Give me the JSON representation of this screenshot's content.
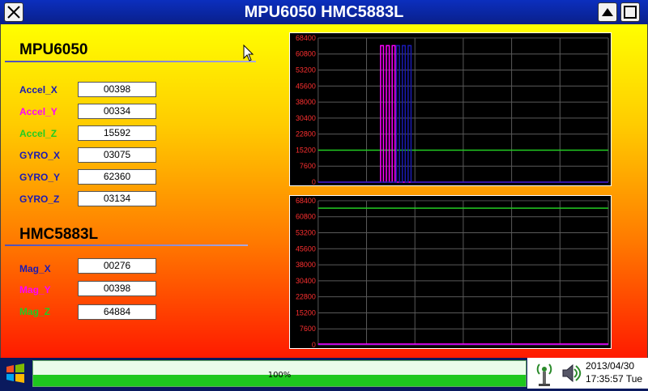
{
  "window": {
    "title": "MPU6050 HMC5883L"
  },
  "mpu": {
    "header": "MPU6050",
    "sensors": [
      {
        "label": "Accel_X",
        "value": "00398",
        "color": "#1a1ab4"
      },
      {
        "label": "Accel_Y",
        "value": "00334",
        "color": "#ff00ff"
      },
      {
        "label": "Accel_Z",
        "value": "15592",
        "color": "#22cc22"
      },
      {
        "label": "GYRO_X",
        "value": "03075",
        "color": "#1a1ab4"
      },
      {
        "label": "GYRO_Y",
        "value": "62360",
        "color": "#1a1ab4"
      },
      {
        "label": "GYRO_Z",
        "value": "03134",
        "color": "#1a1ab4"
      }
    ]
  },
  "hmc": {
    "header": "HMC5883L",
    "sensors": [
      {
        "label": "Mag_X",
        "value": "00276",
        "color": "#1a1ab4"
      },
      {
        "label": "Mag_Y",
        "value": "00398",
        "color": "#ff00ff"
      },
      {
        "label": "Mag_Z",
        "value": "64884",
        "color": "#22cc22"
      }
    ]
  },
  "chart_data": [
    {
      "type": "line",
      "ylim": [
        0,
        68400
      ],
      "yticks": [
        "68400",
        "60800",
        "53200",
        "45600",
        "38000",
        "30400",
        "22800",
        "15200",
        "7600",
        "0"
      ],
      "grid": true,
      "series": [
        {
          "color": "#22cc22",
          "x": [
            0,
            100
          ],
          "y": [
            15200,
            15200
          ]
        },
        {
          "color": "#ff00ff",
          "x": [
            0,
            21.5,
            21.5,
            22.5,
            22.5,
            23.5,
            23.5,
            24.5,
            24.5,
            25.5,
            25.5,
            26.5,
            26.5,
            100
          ],
          "y": [
            0,
            0,
            64800,
            64800,
            0,
            0,
            64800,
            64800,
            0,
            0,
            64800,
            64800,
            0,
            0
          ]
        },
        {
          "color": "#1a1ab4",
          "x": [
            0,
            27,
            27,
            28,
            28,
            29,
            29,
            30,
            30,
            31,
            31,
            32,
            32,
            100
          ],
          "y": [
            0,
            0,
            64800,
            64800,
            0,
            0,
            64800,
            64800,
            0,
            0,
            64800,
            64800,
            0,
            0
          ]
        }
      ]
    },
    {
      "type": "line",
      "ylim": [
        0,
        68400
      ],
      "yticks": [
        "68400",
        "60800",
        "53200",
        "45600",
        "38000",
        "30400",
        "22800",
        "15200",
        "7600",
        "0"
      ],
      "grid": true,
      "series": [
        {
          "color": "#22cc22",
          "x": [
            0,
            100
          ],
          "y": [
            64884,
            64884
          ]
        },
        {
          "color": "#1a1ab4",
          "x": [
            0,
            100
          ],
          "y": [
            276,
            276
          ]
        },
        {
          "color": "#ff00ff",
          "x": [
            0,
            100
          ],
          "y": [
            398,
            398
          ]
        }
      ]
    }
  ],
  "taskbar": {
    "progress_label": "100%",
    "progress": 1.0,
    "date": "2013/04/30",
    "time": "17:35:57 Tue"
  },
  "colors": {
    "titlebar": "#0a1f8a",
    "chart_bg": "#000000",
    "grid": "#5a5a5a",
    "axis_text": "#ff3030"
  }
}
